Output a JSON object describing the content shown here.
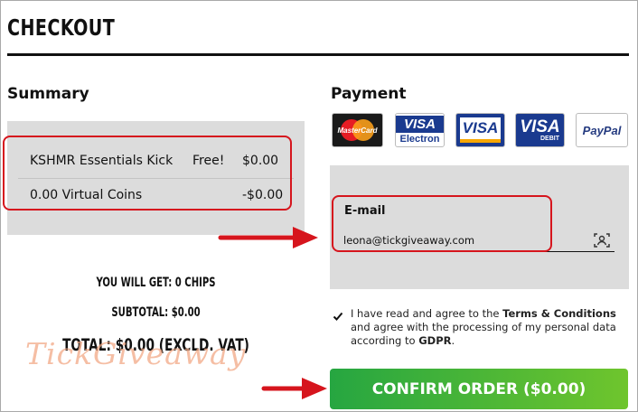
{
  "page": {
    "title": "CHECKOUT"
  },
  "summary": {
    "heading": "Summary",
    "items": [
      {
        "name": "KSHMR Essentials Kick",
        "note": "Free!",
        "price": "$0.00"
      },
      {
        "name": "0.00 Virtual Coins",
        "note": "",
        "price": "-$0.00"
      }
    ],
    "you_will_get": "YOU WILL GET: 0 CHIPS",
    "subtotal": "SUBTOTAL: $0.00",
    "total": "TOTAL: $0.00 (EXCLD. VAT)"
  },
  "watermark": "TickGiveaway",
  "payment": {
    "heading": "Payment",
    "cards": [
      {
        "icon": "mastercard-icon",
        "label": "MasterCard"
      },
      {
        "icon": "visa-electron-icon",
        "label": "VISA",
        "sub": "Electron"
      },
      {
        "icon": "visa-icon",
        "label": "VISA"
      },
      {
        "icon": "visa-debit-icon",
        "label": "VISA",
        "sub": "DEBIT"
      },
      {
        "icon": "paypal-icon",
        "label": "PayPal"
      }
    ],
    "email_label": "E-mail",
    "email_value": "leona@tickgiveaway.com",
    "agree_text_1": "I have read and agree to the ",
    "agree_terms": "Terms & Conditions",
    "agree_text_2": " and agree with the processing of my personal data according to ",
    "agree_gdpr": "GDPR",
    "agree_text_3": ".",
    "confirm_label": "CONFIRM ORDER ($0.00)"
  },
  "colors": {
    "confirm_start": "#26a641",
    "confirm_end": "#6fc52d",
    "annotation_red": "#d6151d",
    "panel_gray": "#dcdcdc"
  }
}
